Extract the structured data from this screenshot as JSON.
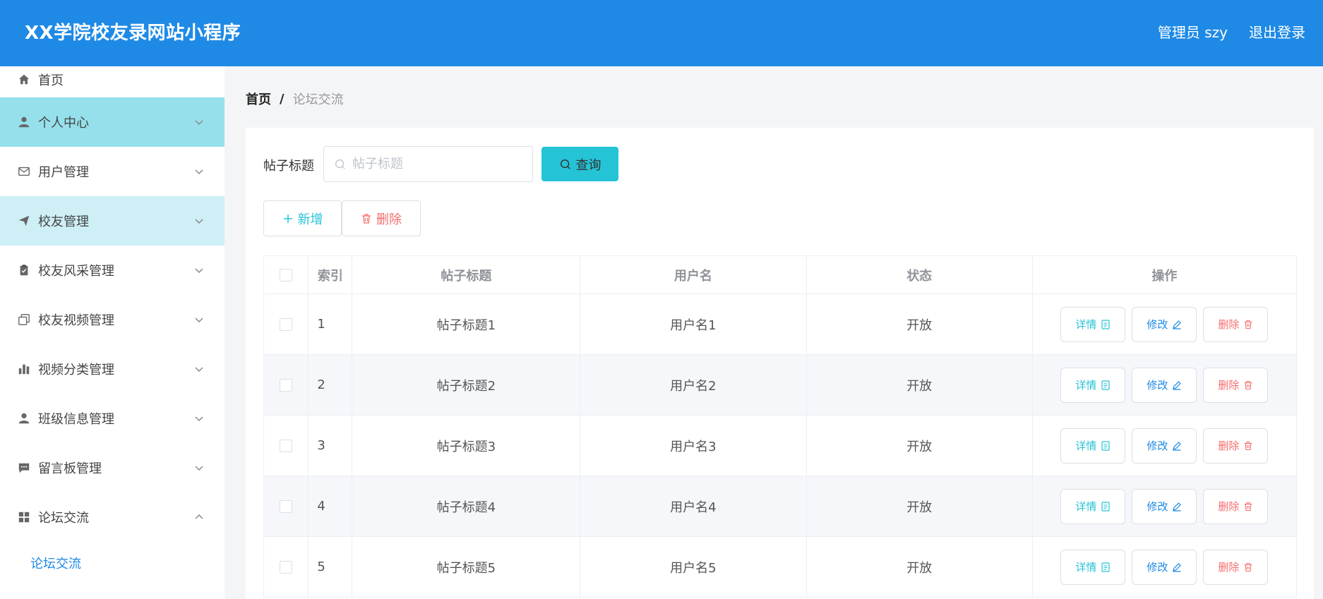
{
  "header": {
    "title": "XX学院校友录网站小程序",
    "user": "管理员 szy",
    "logout": "退出登录"
  },
  "sidebar": {
    "items": [
      {
        "label": "首页",
        "icon": "home-icon"
      },
      {
        "label": "个人中心",
        "icon": "user-icon"
      },
      {
        "label": "用户管理",
        "icon": "mail-icon"
      },
      {
        "label": "校友管理",
        "icon": "send-icon"
      },
      {
        "label": "校友风采管理",
        "icon": "clipboard-icon"
      },
      {
        "label": "校友视频管理",
        "icon": "copy-icon"
      },
      {
        "label": "视频分类管理",
        "icon": "bar-chart-icon"
      },
      {
        "label": "班级信息管理",
        "icon": "user-icon"
      },
      {
        "label": "留言板管理",
        "icon": "message-icon"
      },
      {
        "label": "论坛交流",
        "icon": "grid-icon"
      }
    ],
    "sub_item": "论坛交流"
  },
  "breadcrumb": {
    "home": "首页",
    "separator": "/",
    "current": "论坛交流"
  },
  "search": {
    "label": "帖子标题",
    "placeholder": "帖子标题",
    "button": "查询"
  },
  "actions": {
    "add": "新增",
    "delete": "删除"
  },
  "table": {
    "headers": [
      "索引",
      "帖子标题",
      "用户名",
      "状态",
      "操作"
    ],
    "rows": [
      {
        "index": "1",
        "title": "帖子标题1",
        "user": "用户名1",
        "status": "开放"
      },
      {
        "index": "2",
        "title": "帖子标题2",
        "user": "用户名2",
        "status": "开放"
      },
      {
        "index": "3",
        "title": "帖子标题3",
        "user": "用户名3",
        "status": "开放"
      },
      {
        "index": "4",
        "title": "帖子标题4",
        "user": "用户名4",
        "status": "开放"
      },
      {
        "index": "5",
        "title": "帖子标题5",
        "user": "用户名5",
        "status": "开放"
      }
    ],
    "ops": {
      "view": "详情",
      "edit": "修改",
      "delete": "删除"
    }
  },
  "colors": {
    "primary": "#1f8ae6",
    "accent": "#25c3d6",
    "danger": "#f56c6c",
    "highlight": "#96e0ec",
    "highlight_light": "#cdeff5"
  }
}
